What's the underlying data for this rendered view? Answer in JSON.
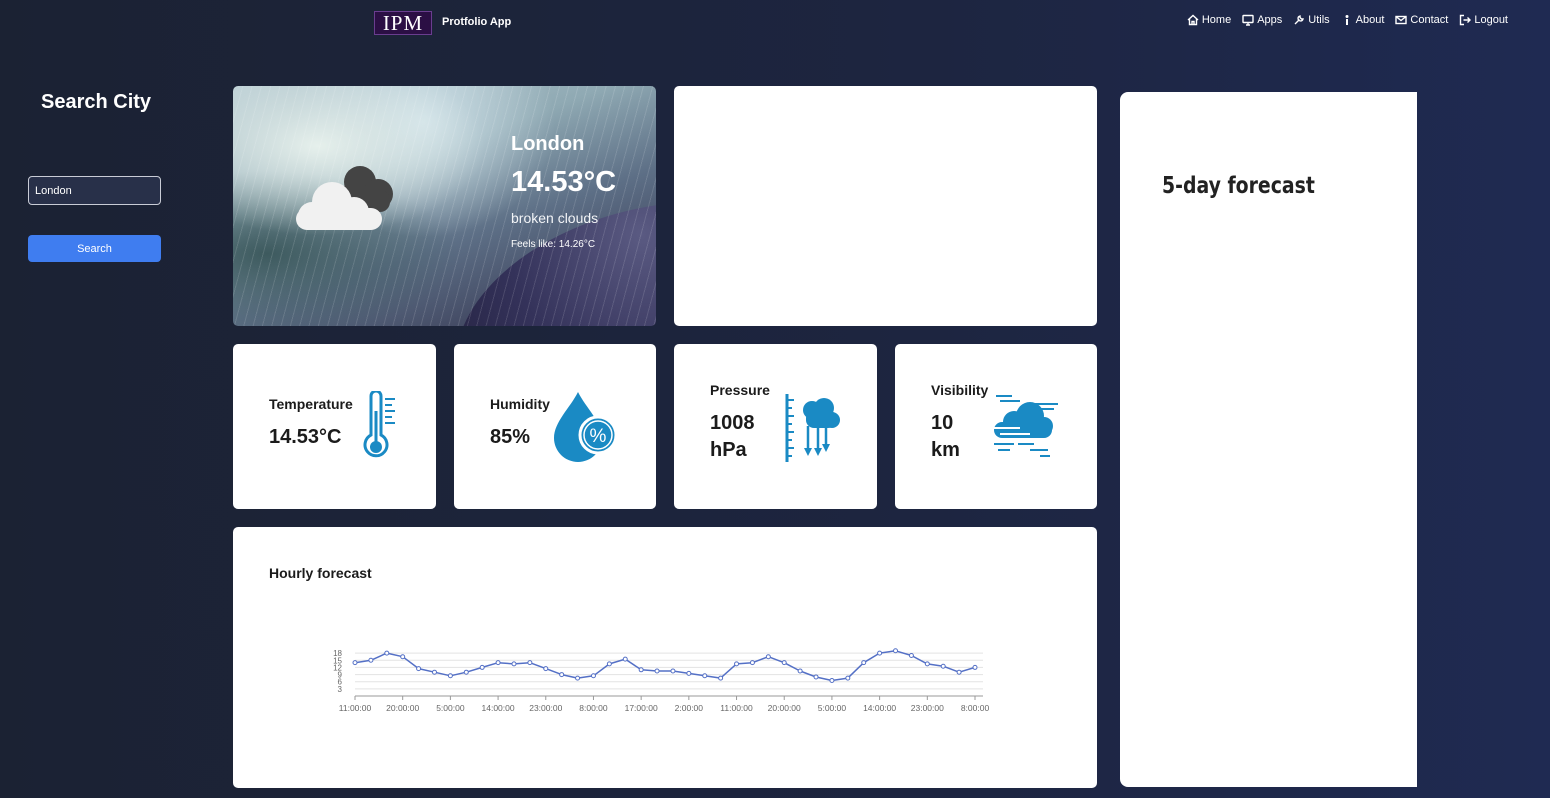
{
  "navbar": {
    "logo_text": "IPM",
    "app_name": "Protfolio App",
    "items": [
      {
        "label": "Home",
        "icon": "home-icon"
      },
      {
        "label": "Apps",
        "icon": "monitor-icon"
      },
      {
        "label": "Utils",
        "icon": "wrench-icon"
      },
      {
        "label": "About",
        "icon": "info-icon"
      },
      {
        "label": "Contact",
        "icon": "envelope-icon"
      },
      {
        "label": "Logout",
        "icon": "logout-icon"
      }
    ]
  },
  "sidebar": {
    "title": "Search City",
    "input_value": "London",
    "search_label": "Search"
  },
  "current": {
    "city": "London",
    "temperature": "14.53°C",
    "description": "broken clouds",
    "feels_like": "Feels like: 14.26°C",
    "icon": "broken-clouds-icon"
  },
  "stats": {
    "temperature": {
      "label": "Temperature",
      "value": "14.53°C",
      "icon": "thermometer-icon"
    },
    "humidity": {
      "label": "Humidity",
      "value": "85%",
      "icon": "humidity-drop-icon"
    },
    "pressure": {
      "label": "Pressure",
      "value_line1": "1008",
      "value_line2": "hPa",
      "icon": "pressure-icon"
    },
    "visibility": {
      "label": "Visibility",
      "value_line1": "10",
      "value_line2": "km",
      "icon": "fog-cloud-icon"
    }
  },
  "hourly": {
    "title": "Hourly forecast"
  },
  "forecast5": {
    "title": "5-day forecast"
  },
  "colors": {
    "accent": "#3f7df0",
    "icon_blue": "#1a8ac4",
    "line": "#5470c6"
  },
  "chart_data": {
    "type": "line",
    "x": [
      "11:00:00",
      "14:00:00",
      "17:00:00",
      "20:00:00",
      "23:00:00",
      "2:00:00",
      "5:00:00",
      "8:00:00",
      "11:00:00",
      "14:00:00",
      "17:00:00",
      "20:00:00",
      "23:00:00",
      "2:00:00",
      "5:00:00",
      "8:00:00",
      "11:00:00",
      "14:00:00",
      "17:00:00",
      "20:00:00",
      "23:00:00",
      "2:00:00",
      "5:00:00",
      "8:00:00",
      "11:00:00",
      "14:00:00",
      "17:00:00",
      "20:00:00",
      "23:00:00",
      "2:00:00",
      "5:00:00",
      "8:00:00",
      "11:00:00",
      "14:00:00",
      "17:00:00",
      "20:00:00",
      "23:00:00",
      "2:00:00",
      "5:00:00",
      "8:00:00"
    ],
    "x_tick_labels": [
      "11:00:00",
      "20:00:00",
      "5:00:00",
      "14:00:00",
      "23:00:00",
      "8:00:00",
      "17:00:00",
      "2:00:00",
      "11:00:00",
      "20:00:00",
      "5:00:00",
      "14:00:00",
      "23:00:00",
      "8:00:00"
    ],
    "y_tick_labels": [
      "3",
      "6",
      "9",
      "12",
      "15",
      "18"
    ],
    "series": [
      {
        "values": [
          14,
          15,
          18,
          16.5,
          11.5,
          10,
          8.5,
          10,
          12,
          14,
          13.5,
          14,
          11.5,
          9,
          7.5,
          8.5,
          13.5,
          15.5,
          11,
          10.5,
          10.5,
          9.5,
          8.5,
          7.5,
          13.5,
          14,
          16.5,
          14,
          10.5,
          8,
          6.5,
          7.5,
          14,
          18,
          19,
          17,
          13.5,
          12.5,
          10,
          12
        ]
      }
    ],
    "ylim": [
      0,
      21
    ],
    "grid": true,
    "xlabel": "",
    "ylabel": ""
  }
}
